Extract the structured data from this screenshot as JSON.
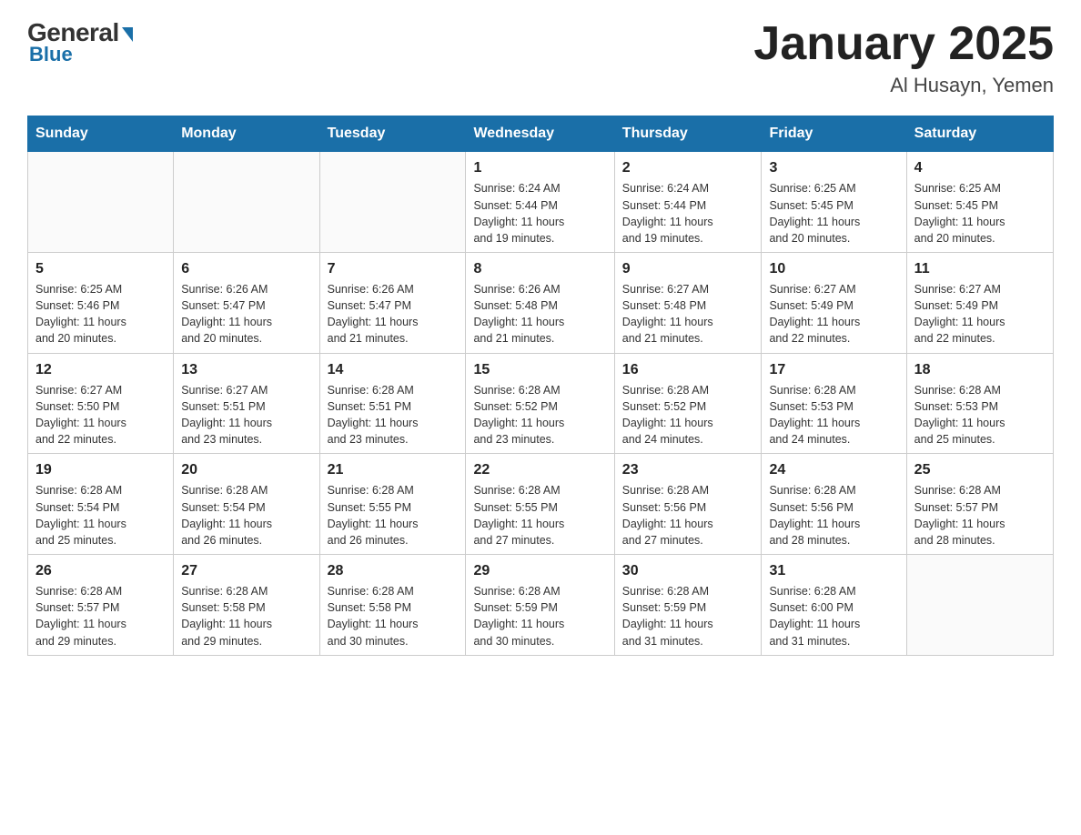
{
  "header": {
    "logo_general": "General",
    "logo_blue": "Blue",
    "title": "January 2025",
    "subtitle": "Al Husayn, Yemen"
  },
  "days_of_week": [
    "Sunday",
    "Monday",
    "Tuesday",
    "Wednesday",
    "Thursday",
    "Friday",
    "Saturday"
  ],
  "weeks": [
    [
      {
        "day": "",
        "info": ""
      },
      {
        "day": "",
        "info": ""
      },
      {
        "day": "",
        "info": ""
      },
      {
        "day": "1",
        "info": "Sunrise: 6:24 AM\nSunset: 5:44 PM\nDaylight: 11 hours\nand 19 minutes."
      },
      {
        "day": "2",
        "info": "Sunrise: 6:24 AM\nSunset: 5:44 PM\nDaylight: 11 hours\nand 19 minutes."
      },
      {
        "day": "3",
        "info": "Sunrise: 6:25 AM\nSunset: 5:45 PM\nDaylight: 11 hours\nand 20 minutes."
      },
      {
        "day": "4",
        "info": "Sunrise: 6:25 AM\nSunset: 5:45 PM\nDaylight: 11 hours\nand 20 minutes."
      }
    ],
    [
      {
        "day": "5",
        "info": "Sunrise: 6:25 AM\nSunset: 5:46 PM\nDaylight: 11 hours\nand 20 minutes."
      },
      {
        "day": "6",
        "info": "Sunrise: 6:26 AM\nSunset: 5:47 PM\nDaylight: 11 hours\nand 20 minutes."
      },
      {
        "day": "7",
        "info": "Sunrise: 6:26 AM\nSunset: 5:47 PM\nDaylight: 11 hours\nand 21 minutes."
      },
      {
        "day": "8",
        "info": "Sunrise: 6:26 AM\nSunset: 5:48 PM\nDaylight: 11 hours\nand 21 minutes."
      },
      {
        "day": "9",
        "info": "Sunrise: 6:27 AM\nSunset: 5:48 PM\nDaylight: 11 hours\nand 21 minutes."
      },
      {
        "day": "10",
        "info": "Sunrise: 6:27 AM\nSunset: 5:49 PM\nDaylight: 11 hours\nand 22 minutes."
      },
      {
        "day": "11",
        "info": "Sunrise: 6:27 AM\nSunset: 5:49 PM\nDaylight: 11 hours\nand 22 minutes."
      }
    ],
    [
      {
        "day": "12",
        "info": "Sunrise: 6:27 AM\nSunset: 5:50 PM\nDaylight: 11 hours\nand 22 minutes."
      },
      {
        "day": "13",
        "info": "Sunrise: 6:27 AM\nSunset: 5:51 PM\nDaylight: 11 hours\nand 23 minutes."
      },
      {
        "day": "14",
        "info": "Sunrise: 6:28 AM\nSunset: 5:51 PM\nDaylight: 11 hours\nand 23 minutes."
      },
      {
        "day": "15",
        "info": "Sunrise: 6:28 AM\nSunset: 5:52 PM\nDaylight: 11 hours\nand 23 minutes."
      },
      {
        "day": "16",
        "info": "Sunrise: 6:28 AM\nSunset: 5:52 PM\nDaylight: 11 hours\nand 24 minutes."
      },
      {
        "day": "17",
        "info": "Sunrise: 6:28 AM\nSunset: 5:53 PM\nDaylight: 11 hours\nand 24 minutes."
      },
      {
        "day": "18",
        "info": "Sunrise: 6:28 AM\nSunset: 5:53 PM\nDaylight: 11 hours\nand 25 minutes."
      }
    ],
    [
      {
        "day": "19",
        "info": "Sunrise: 6:28 AM\nSunset: 5:54 PM\nDaylight: 11 hours\nand 25 minutes."
      },
      {
        "day": "20",
        "info": "Sunrise: 6:28 AM\nSunset: 5:54 PM\nDaylight: 11 hours\nand 26 minutes."
      },
      {
        "day": "21",
        "info": "Sunrise: 6:28 AM\nSunset: 5:55 PM\nDaylight: 11 hours\nand 26 minutes."
      },
      {
        "day": "22",
        "info": "Sunrise: 6:28 AM\nSunset: 5:55 PM\nDaylight: 11 hours\nand 27 minutes."
      },
      {
        "day": "23",
        "info": "Sunrise: 6:28 AM\nSunset: 5:56 PM\nDaylight: 11 hours\nand 27 minutes."
      },
      {
        "day": "24",
        "info": "Sunrise: 6:28 AM\nSunset: 5:56 PM\nDaylight: 11 hours\nand 28 minutes."
      },
      {
        "day": "25",
        "info": "Sunrise: 6:28 AM\nSunset: 5:57 PM\nDaylight: 11 hours\nand 28 minutes."
      }
    ],
    [
      {
        "day": "26",
        "info": "Sunrise: 6:28 AM\nSunset: 5:57 PM\nDaylight: 11 hours\nand 29 minutes."
      },
      {
        "day": "27",
        "info": "Sunrise: 6:28 AM\nSunset: 5:58 PM\nDaylight: 11 hours\nand 29 minutes."
      },
      {
        "day": "28",
        "info": "Sunrise: 6:28 AM\nSunset: 5:58 PM\nDaylight: 11 hours\nand 30 minutes."
      },
      {
        "day": "29",
        "info": "Sunrise: 6:28 AM\nSunset: 5:59 PM\nDaylight: 11 hours\nand 30 minutes."
      },
      {
        "day": "30",
        "info": "Sunrise: 6:28 AM\nSunset: 5:59 PM\nDaylight: 11 hours\nand 31 minutes."
      },
      {
        "day": "31",
        "info": "Sunrise: 6:28 AM\nSunset: 6:00 PM\nDaylight: 11 hours\nand 31 minutes."
      },
      {
        "day": "",
        "info": ""
      }
    ]
  ]
}
